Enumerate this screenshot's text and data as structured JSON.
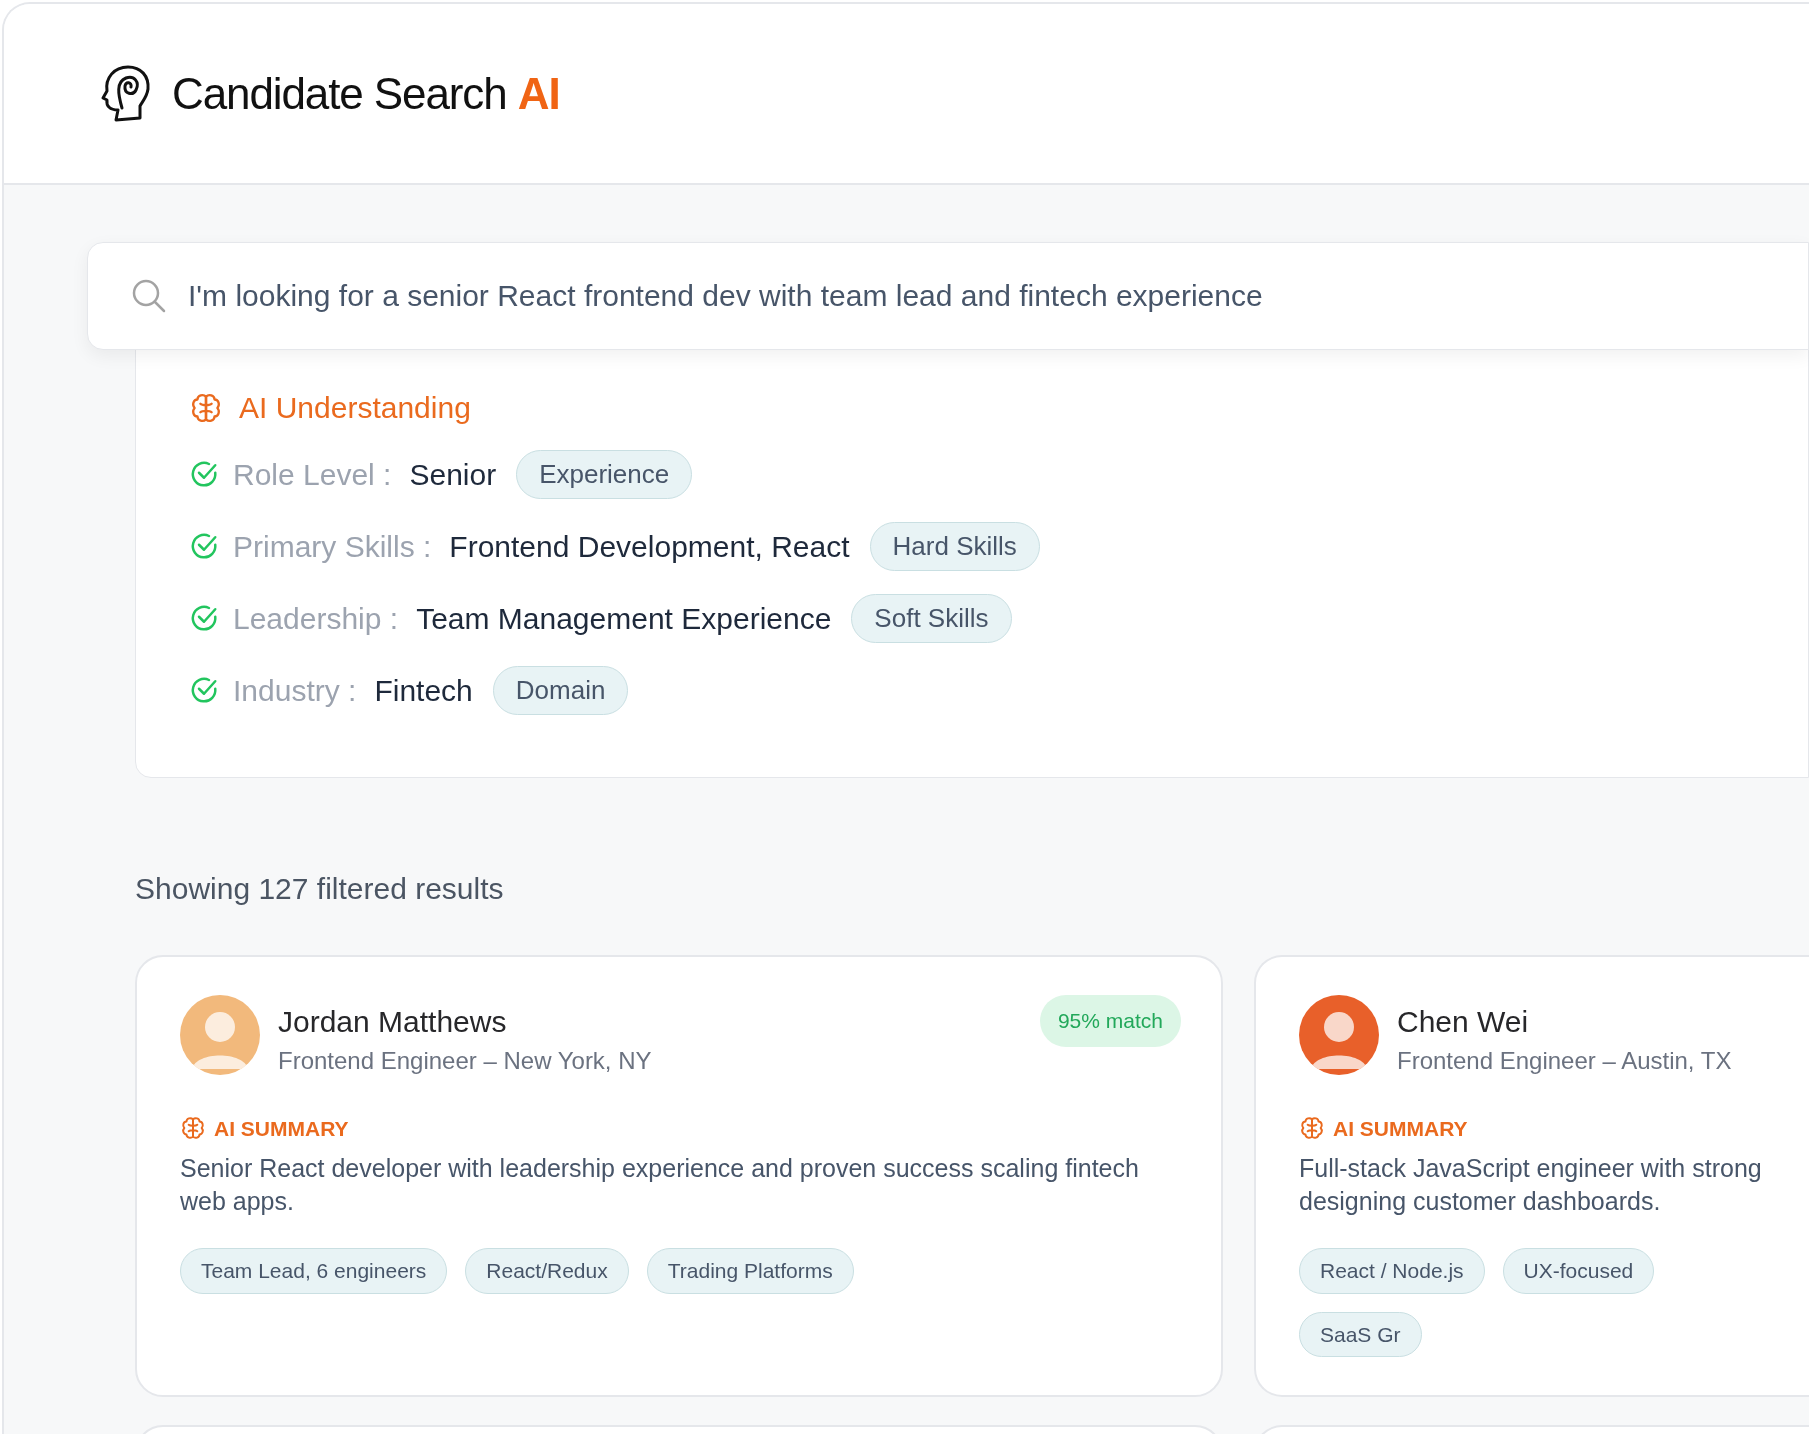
{
  "app": {
    "title": "Candidate Search",
    "title_accent": "AI"
  },
  "search": {
    "value": "I'm looking for a senior React frontend dev with team lead and fintech experience"
  },
  "understanding": {
    "title": "AI Understanding",
    "items": [
      {
        "label": "Role Level :",
        "value": "Senior",
        "tag": "Experience",
        "checked": true
      },
      {
        "label": "Primary Skills :",
        "value": "Frontend Development, React",
        "tag": "Hard Skills",
        "checked": true
      },
      {
        "label": "Leadership :",
        "value": "Team Management Experience",
        "tag": "Soft Skills",
        "checked": true
      },
      {
        "label": "Industry :",
        "value": "Fintech",
        "tag": "Domain",
        "checked": true
      }
    ]
  },
  "results_summary": "Showing 127 filtered results",
  "candidates": [
    {
      "name": "Jordan Matthews",
      "role": "Frontend Engineer – New York, NY",
      "match": "95% match",
      "summary_label": "AI SUMMARY",
      "summary": "Senior React developer with leadership experience and proven success scaling fintech web apps.",
      "tags": [
        "Team Lead, 6 engineers",
        "React/Redux",
        "Trading Platforms"
      ]
    },
    {
      "name": "Chen Wei",
      "role": "Frontend Engineer – Austin, TX",
      "summary_label": "AI SUMMARY",
      "summary": "Full-stack JavaScript engineer with strong designing customer dashboards.",
      "tags": [
        "React / Node.js",
        "UX-focused",
        "SaaS Gr"
      ]
    }
  ]
}
